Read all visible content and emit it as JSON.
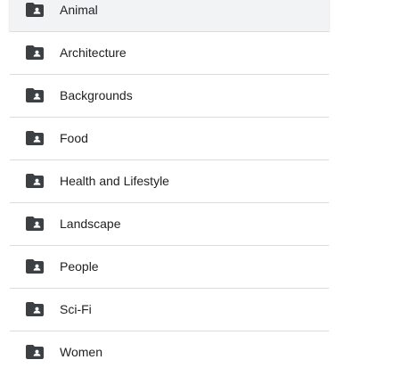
{
  "folders": {
    "icon": "shared-folder-icon",
    "icon_color": "#3c4043",
    "items": [
      {
        "label": "Animal"
      },
      {
        "label": "Architecture"
      },
      {
        "label": "Backgrounds"
      },
      {
        "label": "Food"
      },
      {
        "label": "Health and Lifestyle"
      },
      {
        "label": "Landscape"
      },
      {
        "label": "People"
      },
      {
        "label": "Sci-Fi"
      },
      {
        "label": "Women"
      }
    ]
  }
}
